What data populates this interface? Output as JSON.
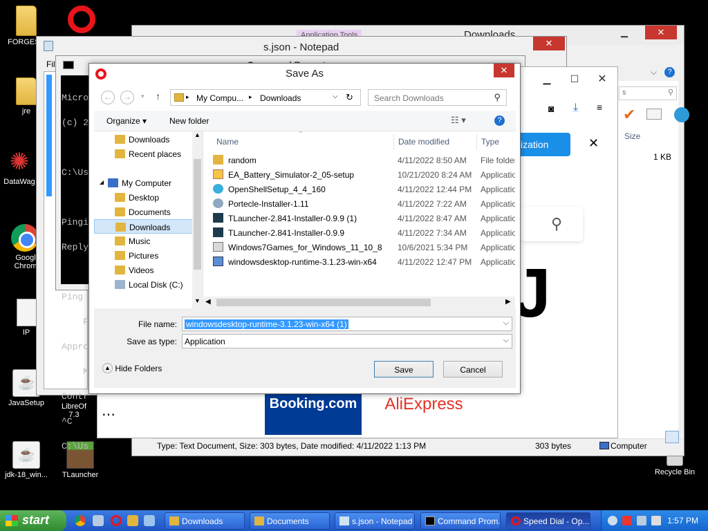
{
  "desktop": {
    "icons": [
      {
        "label": "FORGESE"
      },
      {
        "label": "jre"
      },
      {
        "label": "DataWag"
      },
      {
        "label": "Googl Chrom"
      },
      {
        "label": "IP"
      },
      {
        "label": "JavaSetup"
      },
      {
        "label": "LibreOf 7.3"
      },
      {
        "label": "jdk-18_win..."
      },
      {
        "label": "TLauncher"
      },
      {
        "label": "Recycle Bin"
      }
    ]
  },
  "explorer": {
    "title": "Downloads",
    "ribbon_tab": "Application Tools",
    "size_header": "Size",
    "size_value": "1 KB",
    "search_placeholder": "s",
    "status_text": "Type: Text Document, Size: 303 bytes, Date modified: 4/11/2022 1:13 PM",
    "status_size": "303 bytes",
    "status_location": "Computer"
  },
  "notepad": {
    "title": "s.json - Notepad",
    "menu_first": "Fil"
  },
  "cmd": {
    "title": "Command Prompt",
    "lines": [
      "Micro",
      "(c) 2",
      "",
      "C:\\Us",
      "",
      "Pingi",
      "Reply",
      "",
      "Ping",
      "    P",
      "Appro",
      "    M",
      "Contr",
      "^C",
      "C:\\Us"
    ]
  },
  "browser": {
    "blue_button": "ization",
    "tiles": [
      "Booking.com",
      "AliExpress"
    ],
    "big_glyph": "J"
  },
  "save_as": {
    "title": "Save As",
    "address": [
      "My Compu...",
      "Downloads"
    ],
    "search_placeholder": "Search Downloads",
    "organize_label": "Organize",
    "new_folder_label": "New folder",
    "nav": {
      "favorites": [
        "Downloads",
        "Recent places"
      ],
      "computer": "My Computer",
      "computer_items": [
        "Desktop",
        "Documents",
        "Downloads",
        "Music",
        "Pictures",
        "Videos",
        "Local Disk (C:)"
      ]
    },
    "columns": {
      "name": "Name",
      "date": "Date modified",
      "type": "Type"
    },
    "files": [
      {
        "name": "random",
        "date": "4/11/2022 8:50 AM",
        "type": "File folder",
        "icon": "folder-icon"
      },
      {
        "name": "EA_Battery_Simulator-2_05-setup",
        "date": "10/21/2020 8:24 AM",
        "type": "Application",
        "icon": "installer-icon"
      },
      {
        "name": "OpenShellSetup_4_4_160",
        "date": "4/11/2022 12:44 PM",
        "type": "Application",
        "icon": "shell-icon"
      },
      {
        "name": "Portecle-Installer-1.11",
        "date": "4/11/2022 7:22 AM",
        "type": "Application",
        "icon": "setup-icon"
      },
      {
        "name": "TLauncher-2.841-Installer-0.9.9 (1)",
        "date": "4/11/2022 8:47 AM",
        "type": "Application",
        "icon": "tlauncher-icon"
      },
      {
        "name": "TLauncher-2.841-Installer-0.9.9",
        "date": "4/11/2022 7:34 AM",
        "type": "Application",
        "icon": "tlauncher-icon"
      },
      {
        "name": "Windows7Games_for_Windows_11_10_8",
        "date": "10/6/2021 5:34 PM",
        "type": "Application",
        "icon": "setup-icon"
      },
      {
        "name": "windowsdesktop-runtime-3.1.23-win-x64",
        "date": "4/11/2022 12:47 PM",
        "type": "Application",
        "icon": "runtime-icon"
      }
    ],
    "filename_label": "File name:",
    "filename_value": "windowsdesktop-runtime-3.1.23-win-x64 (1)",
    "savetype_label": "Save as type:",
    "savetype_value": "Application",
    "hide_folders": "Hide Folders",
    "save_button": "Save",
    "cancel_button": "Cancel"
  },
  "taskbar": {
    "start": "start",
    "buttons": [
      "Downloads",
      "Documents",
      "s.json - Notepad",
      "Command Prom...",
      "Speed Dial - Op..."
    ],
    "clock": "1:57 PM"
  }
}
